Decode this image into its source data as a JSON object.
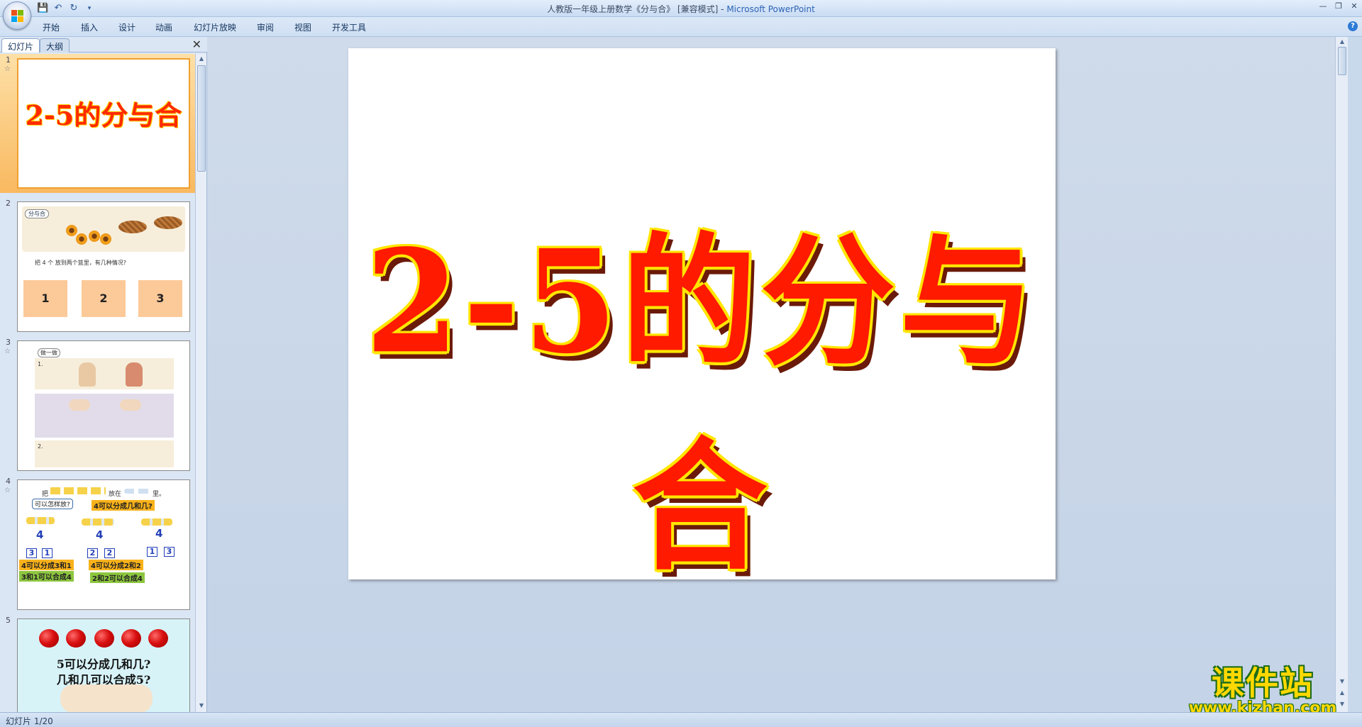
{
  "window": {
    "title": "人教版一年级上册数学《分与合》 [兼容模式] - ",
    "app_name": "Microsoft PowerPoint"
  },
  "ribbon": {
    "tabs": [
      "开始",
      "插入",
      "设计",
      "动画",
      "幻灯片放映",
      "审阅",
      "视图",
      "开发工具"
    ]
  },
  "panel": {
    "tabs": [
      "幻灯片",
      "大纲"
    ],
    "active_tab": "幻灯片"
  },
  "thumbnails": [
    {
      "number": "1",
      "title": "2-5的分与合"
    },
    {
      "number": "2",
      "caption": "分与合",
      "instruction": "把 4 个 放到两个篮里，有几种情况?",
      "boxes": [
        "1",
        "2",
        "3"
      ]
    },
    {
      "number": "3",
      "caption": "做一做",
      "small": [
        "1.",
        "2."
      ]
    },
    {
      "number": "4",
      "labels": {
        "intro": "把",
        "intro2": "放在",
        "intro3": "里。",
        "question1": "可以怎样放?",
        "question2": "4可以分成几和几?",
        "top": [
          "4",
          "4",
          "4"
        ],
        "boxes": [
          [
            "3",
            "1"
          ],
          [
            "2",
            "2"
          ],
          [
            "1",
            "3"
          ]
        ],
        "split1": "4可以分成3和1",
        "split2": "4可以分成2和2",
        "join1": "3和1可以合成4",
        "join2": "2和2可以合成4"
      }
    },
    {
      "number": "5",
      "line1": "5可以分成几和几?",
      "line2": "几和几可以合成5?"
    }
  ],
  "slide": {
    "title": "2-5的分与合"
  },
  "watermark": {
    "title": "课件站",
    "url": "www.kjzhan.com"
  },
  "status": {
    "text": "幻灯片 1/20"
  },
  "colors": {
    "title_fill": "#ff1a00",
    "title_outline": "#ffe600",
    "selected_thumb": "#f9b960"
  }
}
